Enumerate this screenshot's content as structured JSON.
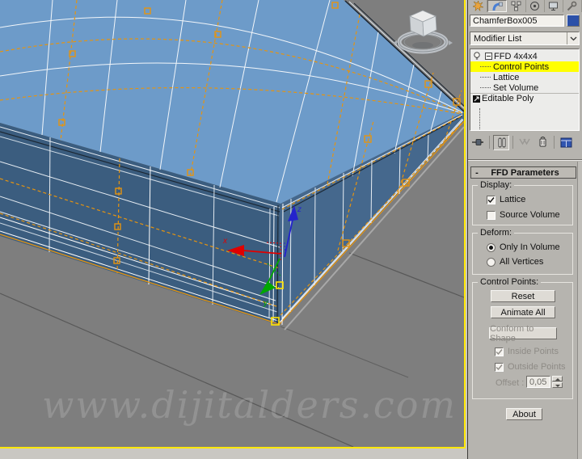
{
  "watermark": "www.dijitalders.com",
  "viewport": {
    "axis_labels": {
      "x": "x",
      "y": "y",
      "z": "z"
    }
  },
  "panel": {
    "tabs": [
      {
        "icon": "create"
      },
      {
        "icon": "modify",
        "active": true
      },
      {
        "icon": "hierarchy"
      },
      {
        "icon": "motion"
      },
      {
        "icon": "display"
      },
      {
        "icon": "utilities"
      }
    ],
    "object_name": "ChamferBox005",
    "modifier_list_label": "Modifier List",
    "stack": {
      "items": [
        {
          "label": "FFD 4x4x4"
        },
        {
          "label": "Control Points",
          "selected": true
        },
        {
          "label": "Lattice"
        },
        {
          "label": "Set Volume"
        },
        {
          "label": "Editable Poly"
        }
      ]
    },
    "stack_toolbar_icons": [
      "pin-stack",
      "show-end-result",
      "make-unique",
      "remove-modifier",
      "configure-modifier-sets"
    ],
    "rollout": {
      "title": "FFD Parameters",
      "collapse_glyph": "-",
      "display_group": {
        "label": "Display:",
        "lattice_label": "Lattice",
        "lattice_checked": true,
        "source_volume_label": "Source Volume",
        "source_volume_checked": false
      },
      "deform_group": {
        "label": "Deform:",
        "only_in_volume_label": "Only In Volume",
        "only_in_volume_selected": true,
        "all_vertices_label": "All Vertices",
        "all_vertices_selected": false
      },
      "control_points_group": {
        "label": "Control Points:",
        "reset_label": "Reset",
        "animate_all_label": "Animate All",
        "conform_label": "Conform to Shape",
        "inside_points_label": "Inside Points",
        "inside_points_checked": true,
        "outside_points_label": "Outside Points",
        "outside_points_checked": true,
        "offset_label": "Offset :",
        "offset_value": "0,05"
      },
      "about_label": "About"
    },
    "colors": {
      "object_color_swatch": "#2b50a8",
      "selection_highlight": "#ffff00",
      "lattice_orange": "#e6940f",
      "viewport_border": "#ffe800"
    }
  }
}
